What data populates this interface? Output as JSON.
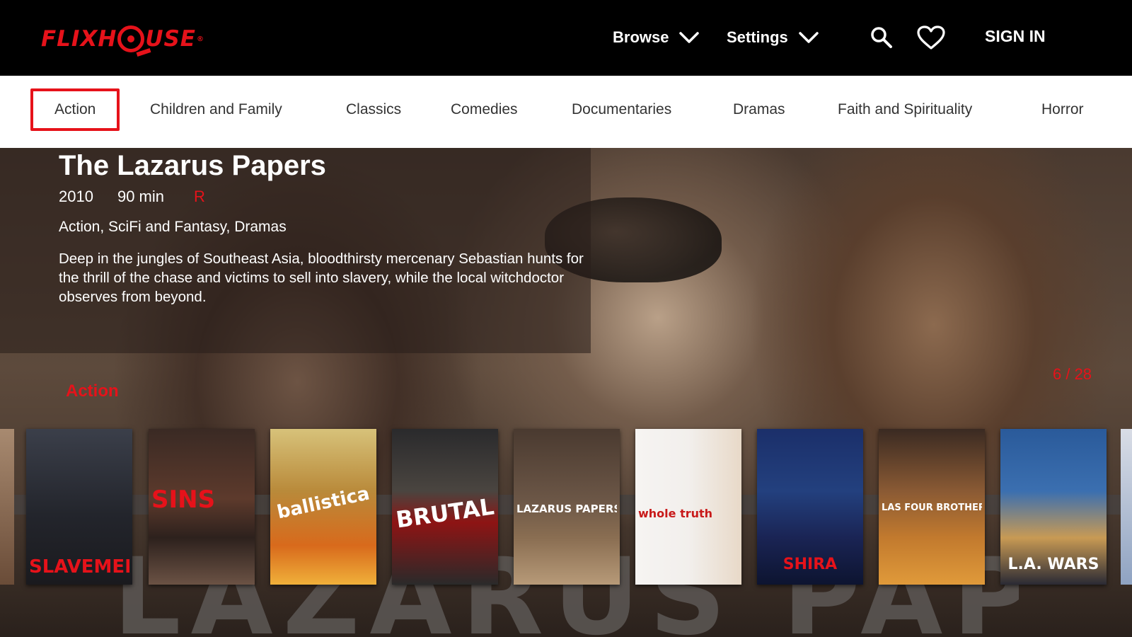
{
  "header": {
    "logo_text_left": "FLIXH",
    "logo_text_right": "USE",
    "logo_reg": "®",
    "browse_label": "Browse",
    "settings_label": "Settings",
    "signin_label": "SIGN IN"
  },
  "genres": [
    "Action",
    "Children and Family",
    "Classics",
    "Comedies",
    "Documentaries",
    "Dramas",
    "Faith and Spirituality",
    "Horror"
  ],
  "selected_genre": "Action",
  "featured": {
    "title": "The Lazarus Papers",
    "year": "2010",
    "runtime": "90 min",
    "rating": "R",
    "genres": "Action, SciFi and Fantasy, Dramas",
    "description": "Deep in the jungles of Southeast Asia, bloodthirsty mercenary Sebastian hunts for the thrill of the chase and victims to sell into slavery, while the local witchdoctor observes from beyond.",
    "backdrop_text": "LAZARUS PAPERS"
  },
  "row": {
    "label": "Action",
    "counter": "6 / 28"
  },
  "posters": [
    {
      "title": "SLAVEMEN"
    },
    {
      "title": "SINS"
    },
    {
      "title": "ballistica"
    },
    {
      "title": "BRUTAL"
    },
    {
      "title": "LAZARUS PAPERS"
    },
    {
      "title": "whole truth"
    },
    {
      "title": "SHIRA"
    },
    {
      "title": "LAS FOUR BROTHERS"
    },
    {
      "title": "L.A. WARS"
    }
  ],
  "colors": {
    "accent": "#e6121a",
    "header_bg": "#000000",
    "genre_bar_bg": "#ffffff"
  },
  "icons": [
    "chevron-down-icon",
    "search-icon",
    "heart-icon"
  ]
}
